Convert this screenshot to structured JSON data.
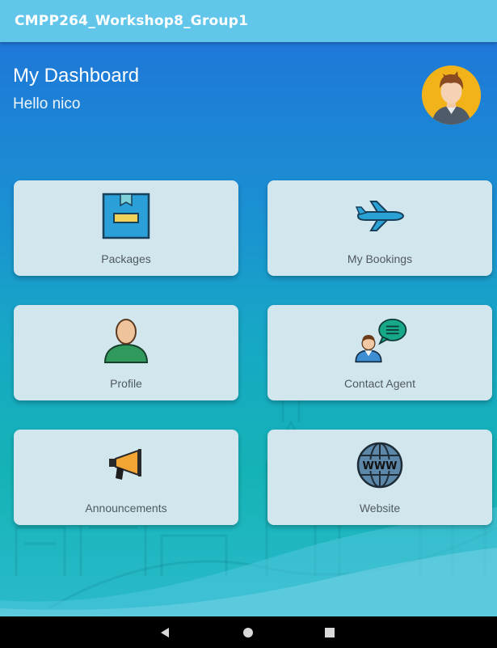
{
  "app_bar": {
    "title": "CMPP264_Workshop8_Group1"
  },
  "header": {
    "title": "My Dashboard",
    "greeting": "Hello nico"
  },
  "tiles": [
    {
      "label": "Packages",
      "icon": "package-box-icon"
    },
    {
      "label": "My Bookings",
      "icon": "airplane-icon"
    },
    {
      "label": "Profile",
      "icon": "person-icon"
    },
    {
      "label": "Contact Agent",
      "icon": "agent-chat-icon"
    },
    {
      "label": "Announcements",
      "icon": "megaphone-icon"
    },
    {
      "label": "Website",
      "icon": "www-globe-icon"
    }
  ],
  "navbar": {
    "buttons": [
      "back-icon",
      "home-icon",
      "recents-icon"
    ]
  },
  "colors": {
    "app_bar": "#62c6ea",
    "gradient_top": "#1e78d8",
    "gradient_bottom": "#2bbacb",
    "tile_bg": "#d2e6ee",
    "tile_text": "#505a5e"
  }
}
